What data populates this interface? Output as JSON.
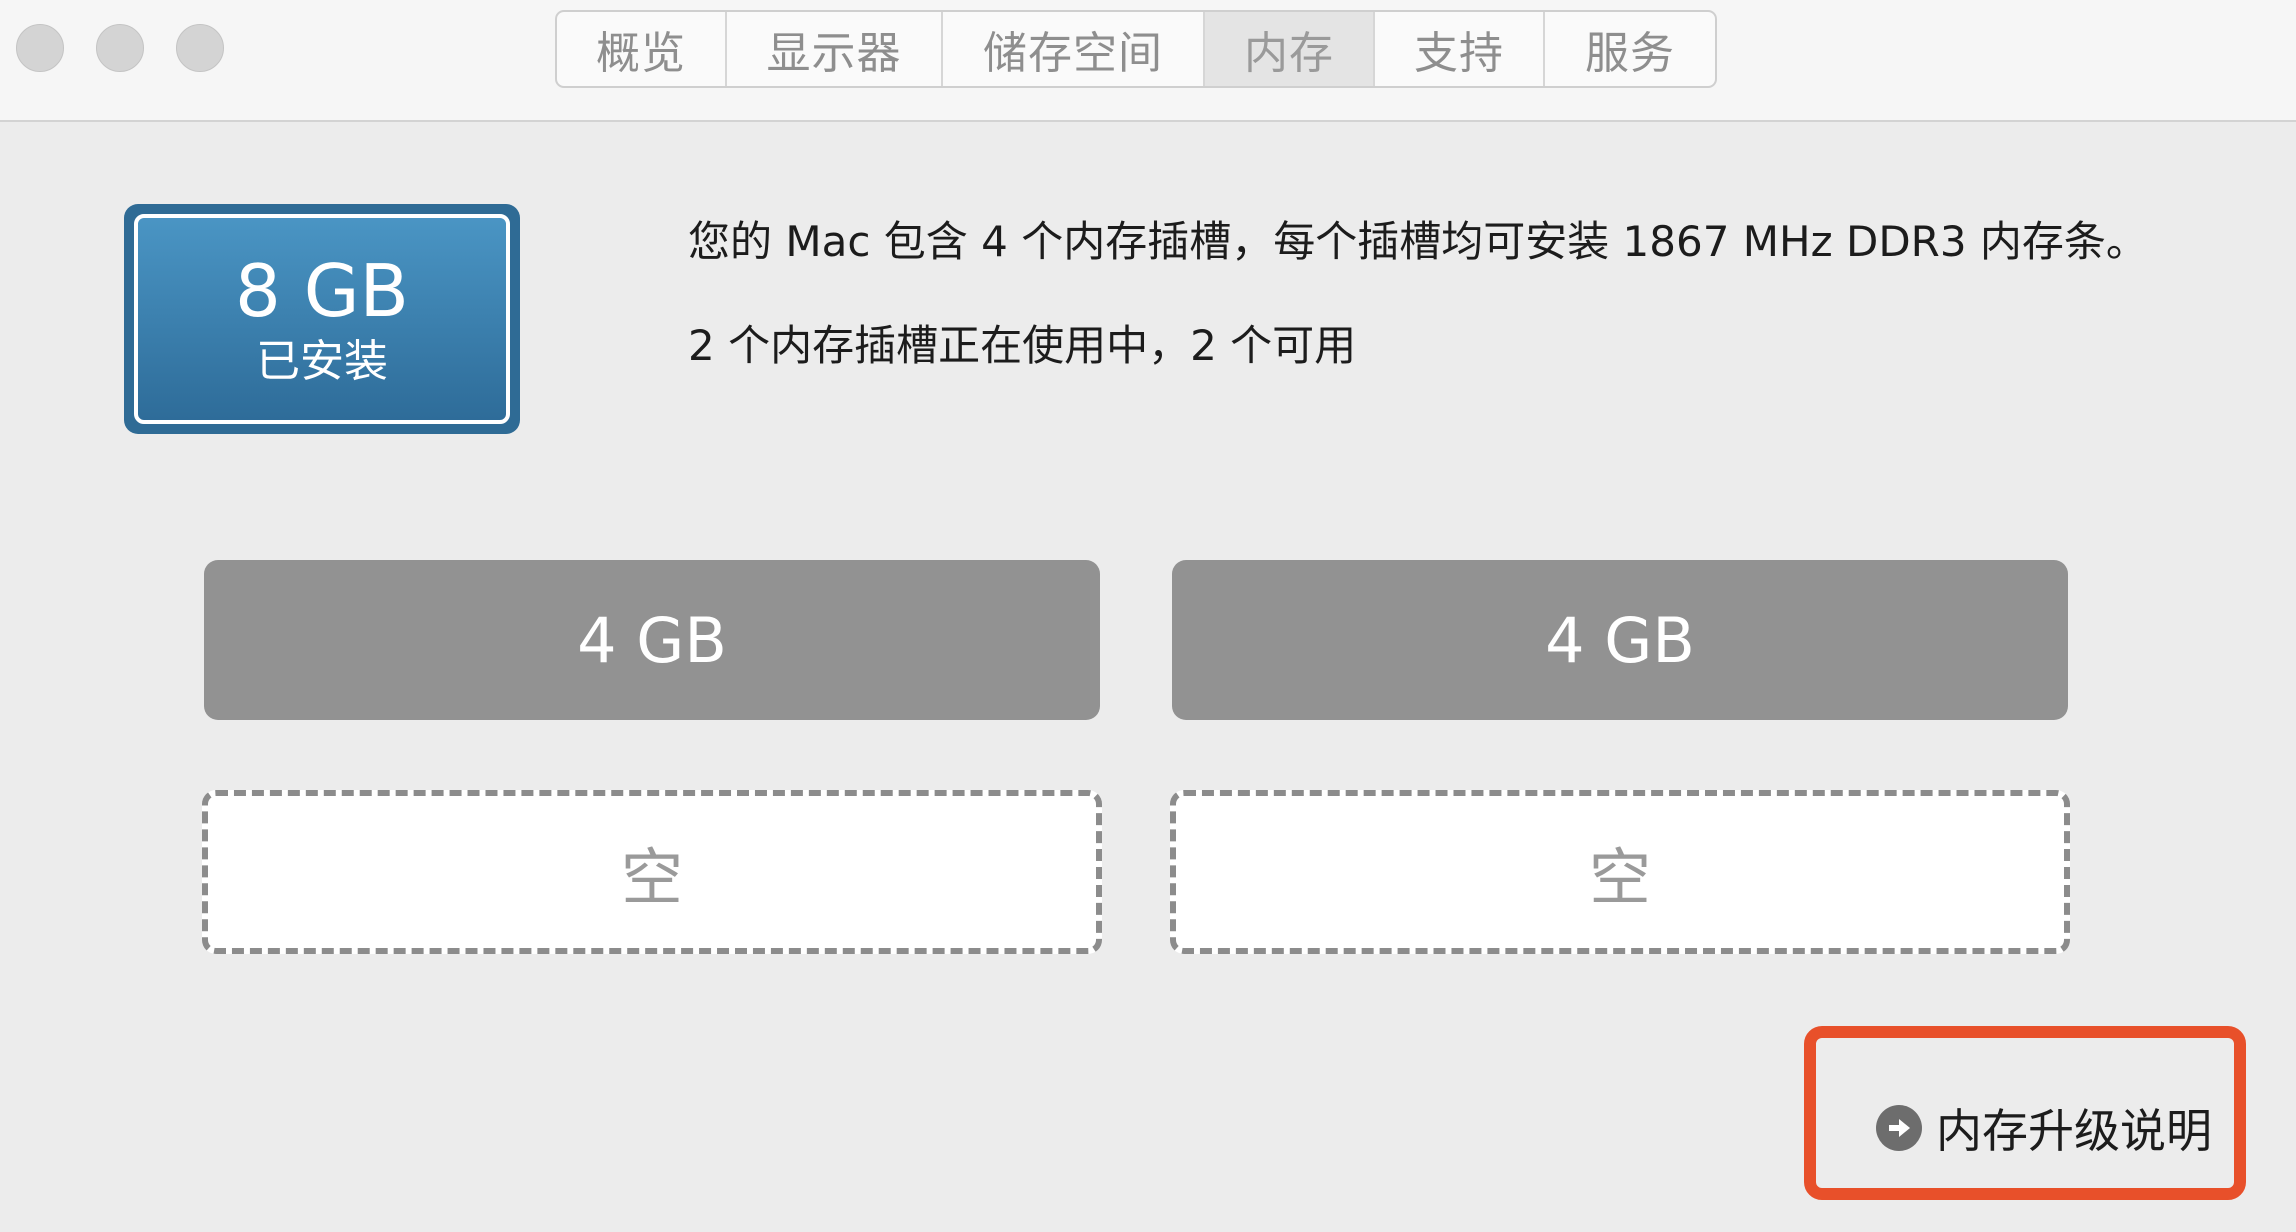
{
  "tabs": [
    {
      "label": "概览",
      "active": false
    },
    {
      "label": "显示器",
      "active": false
    },
    {
      "label": "储存空间",
      "active": false
    },
    {
      "label": "内存",
      "active": true
    },
    {
      "label": "支持",
      "active": false
    },
    {
      "label": "服务",
      "active": false
    }
  ],
  "installed": {
    "size": "8 GB",
    "label": "已安装"
  },
  "info": {
    "line1": "您的 Mac 包含 4 个内存插槽，每个插槽均可安装 1867 MHz DDR3 内存条。",
    "line2": "2 个内存插槽正在使用中，2 个可用"
  },
  "slots": [
    {
      "label": "4 GB",
      "state": "filled"
    },
    {
      "label": "4 GB",
      "state": "filled"
    },
    {
      "label": "空",
      "state": "empty"
    },
    {
      "label": "空",
      "state": "empty"
    }
  ],
  "upgrade_link": {
    "label": "内存升级说明",
    "icon": "arrow-circle-right-icon"
  },
  "colors": {
    "accent": "#3d82b2",
    "highlight": "#e8502a"
  }
}
